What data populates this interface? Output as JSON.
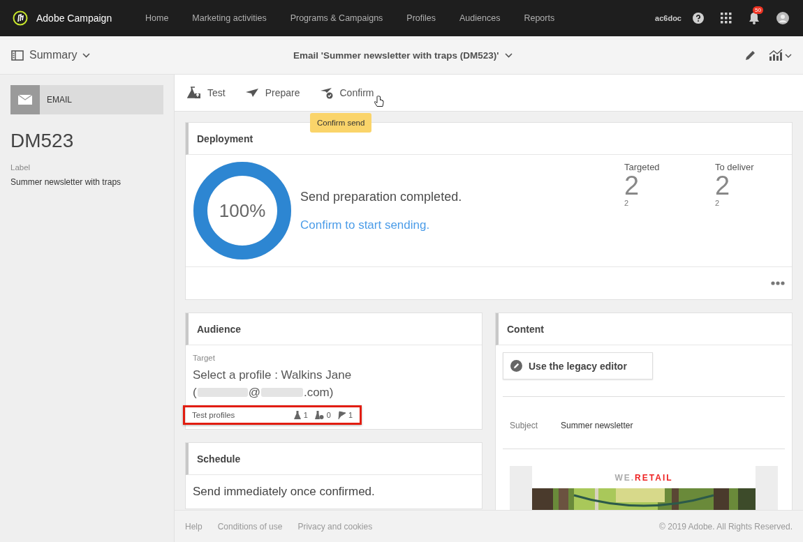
{
  "app": {
    "name": "Adobe Campaign"
  },
  "nav": [
    {
      "label": "Home"
    },
    {
      "label": "Marketing activities"
    },
    {
      "label": "Programs & Campaigns"
    },
    {
      "label": "Profiles"
    },
    {
      "label": "Audiences"
    },
    {
      "label": "Reports"
    }
  ],
  "user": {
    "org": "ac6doc",
    "notifications": "50"
  },
  "subheader": {
    "view": "Summary",
    "view_expanded": false,
    "title": "Email 'Summer newsletter with traps (DM523)'"
  },
  "sidebar": {
    "type": "EMAIL",
    "id": "DM523",
    "label_caption": "Label",
    "label": "Summer newsletter with traps"
  },
  "toolbar": [
    {
      "label": "Test",
      "kind": "test"
    },
    {
      "label": "Prepare",
      "kind": "prepare"
    },
    {
      "label": "Confirm",
      "kind": "confirm"
    }
  ],
  "tooltip": "Confirm send",
  "deployment": {
    "title": "Deployment",
    "progress": {
      "level": 1.0,
      "reading": "100%"
    },
    "status": "Send preparation completed.",
    "action": "Confirm to start sending.",
    "stats": [
      {
        "label": "Targeted",
        "value": "2",
        "sub": "2"
      },
      {
        "label": "To deliver",
        "value": "2",
        "sub": "2"
      }
    ]
  },
  "audience": {
    "title": "Audience",
    "caption": "Target",
    "target_prefix": "Select a profile : Walkins Jane",
    "email_parts": [
      {
        "kind": "text",
        "text": "("
      },
      {
        "kind": "redacted"
      },
      {
        "kind": "text",
        "text": "@"
      },
      {
        "kind": "redacted"
      },
      {
        "kind": "text",
        "text": ".com)"
      }
    ],
    "test_profiles": {
      "label": "Test profiles",
      "counts": [
        {
          "kind": "flask",
          "value": "1"
        },
        {
          "kind": "flask-check",
          "value": "0"
        },
        {
          "kind": "trap",
          "value": "1"
        }
      ]
    }
  },
  "schedule": {
    "title": "Schedule",
    "text": "Send immediately once confirmed."
  },
  "content": {
    "title": "Content",
    "editor_button": "Use the legacy editor",
    "subject_caption": "Subject",
    "subject": "Summer newsletter",
    "preview_brand_a": "WE.",
    "preview_brand_b": "RETAIL"
  },
  "footer": {
    "links": [
      {
        "label": "Help"
      },
      {
        "label": "Conditions of use"
      },
      {
        "label": "Privacy and cookies"
      }
    ],
    "copyright": "© 2019 Adobe. All Rights Reserved."
  }
}
